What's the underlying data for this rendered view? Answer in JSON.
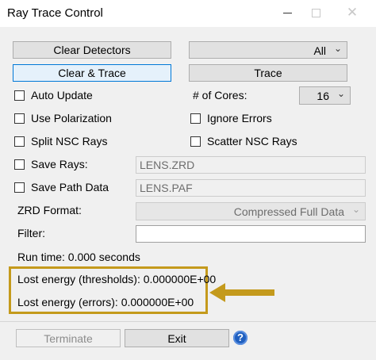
{
  "window": {
    "title": "Ray Trace Control"
  },
  "buttons": {
    "clear_detectors": "Clear Detectors",
    "clear_trace": "Clear & Trace",
    "trace": "Trace",
    "terminate": "Terminate",
    "exit": "Exit",
    "help_glyph": "?"
  },
  "dropdowns": {
    "detector": "All",
    "cores": "16",
    "zrd_format": "Compressed Full Data"
  },
  "checkboxes": {
    "auto_update": "Auto Update",
    "use_polarization": "Use Polarization",
    "split_nsc_rays": "Split NSC Rays",
    "save_rays": "Save Rays:",
    "save_path_data": "Save Path Data",
    "ignore_errors": "Ignore Errors",
    "scatter_nsc_rays": "Scatter NSC Rays"
  },
  "labels": {
    "cores": "# of Cores:",
    "zrd_format": "ZRD Format:",
    "filter": "Filter:"
  },
  "fields": {
    "save_rays_file": "LENS.ZRD",
    "save_path_file": "LENS.PAF",
    "filter": ""
  },
  "status": {
    "run_time": "Run time: 0.000 seconds",
    "lost_thresholds": "Lost energy (thresholds): 0.000000E+00",
    "lost_errors": "Lost energy (errors): 0.000000E+00"
  },
  "colors": {
    "highlight": "#c49a1c",
    "focus": "#0078d7"
  }
}
